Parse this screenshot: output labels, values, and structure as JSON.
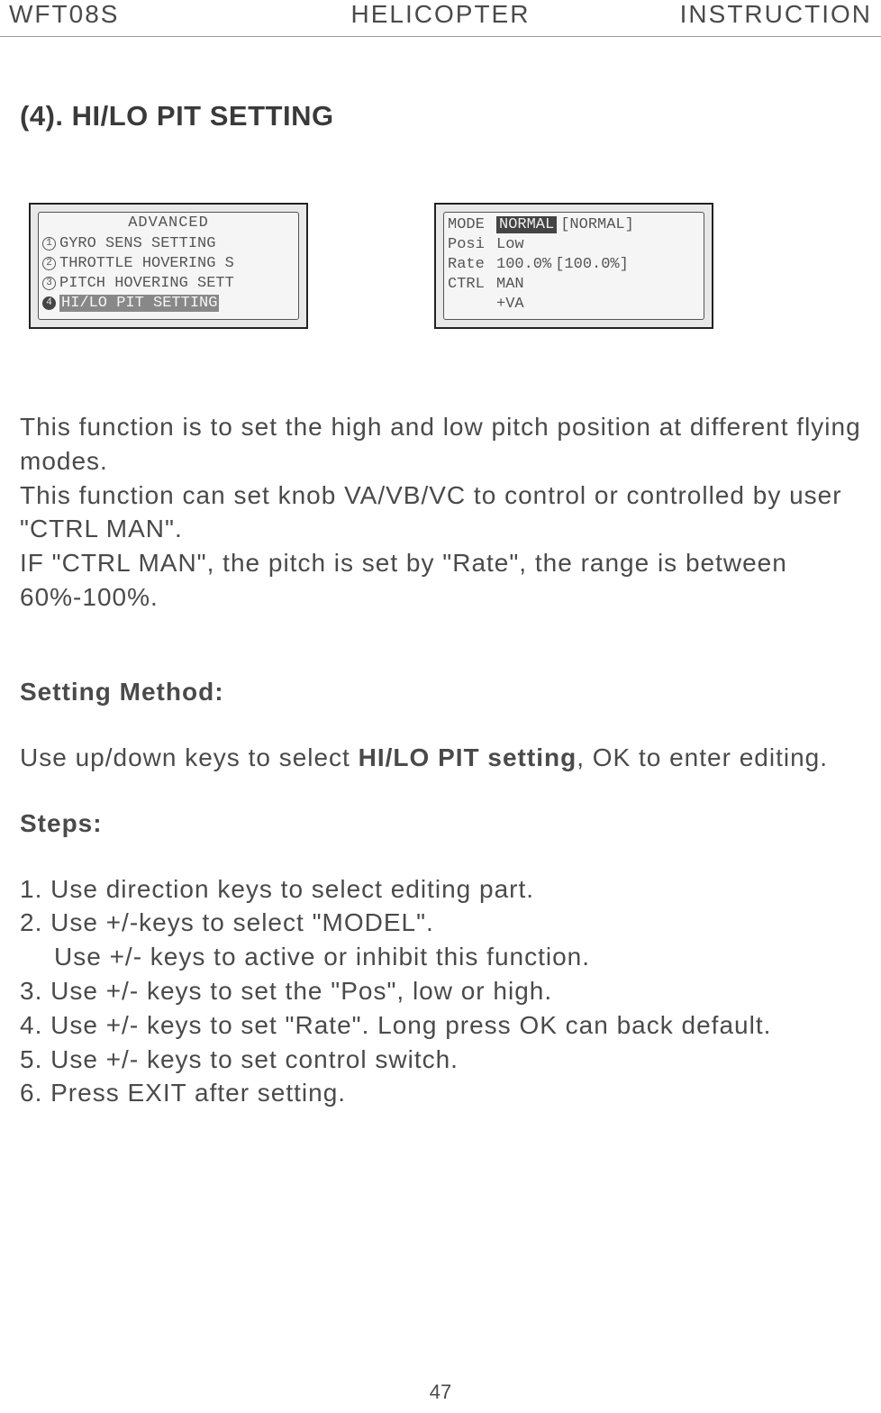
{
  "header": {
    "left": "WFT08S",
    "center": "HELICOPTER",
    "right": "INSTRUCTION"
  },
  "section_title": "(4). HI/LO PIT SETTING",
  "screen1": {
    "title": "ADVANCED",
    "rows": [
      {
        "num": "1",
        "text": "GYRO SENS SETTING"
      },
      {
        "num": "2",
        "text": "THROTTLE HOVERING S"
      },
      {
        "num": "3",
        "text": "PITCH HOVERING SETT"
      },
      {
        "num": "4",
        "text": "HI/LO PIT SETTING"
      }
    ]
  },
  "screen2": {
    "rows": [
      {
        "label": "MODE",
        "highlight": "NORMAL",
        "bracket": "[NORMAL]"
      },
      {
        "label": "Posi",
        "value": "Low"
      },
      {
        "label": "Rate",
        "value": "100.0%",
        "bracket": "[100.0%]"
      },
      {
        "label": "CTRL",
        "value": "MAN"
      },
      {
        "label": "",
        "value": "+VA"
      }
    ]
  },
  "description": {
    "p1": "This function is to set the high and low pitch position  at different flying modes.",
    "p2": "This function can set knob VA/VB/VC to control or controlled by user \"CTRL MAN\".",
    "p3": "IF \"CTRL MAN\", the pitch is set by \"Rate\", the range is between 60%-100%."
  },
  "setting_method_label": "Setting Method:",
  "method_text_pre": "Use up/down keys to select ",
  "method_text_bold": "HI/LO PIT setting",
  "method_text_post": ", OK to enter editing.",
  "steps_label": "Steps:",
  "steps": {
    "s1": "1. Use direction keys to select editing part.",
    "s2": "2. Use +/-keys to select \"MODEL\".",
    "s2b": "Use +/- keys to active or inhibit this function.",
    "s3": "3. Use +/- keys to set the \"Pos\", low or high.",
    "s4": "4. Use +/- keys to set \"Rate\". Long press OK can back default.",
    "s5": "5. Use +/- keys to set control switch.",
    "s6": "6. Press EXIT after setting."
  },
  "page_number": "47"
}
